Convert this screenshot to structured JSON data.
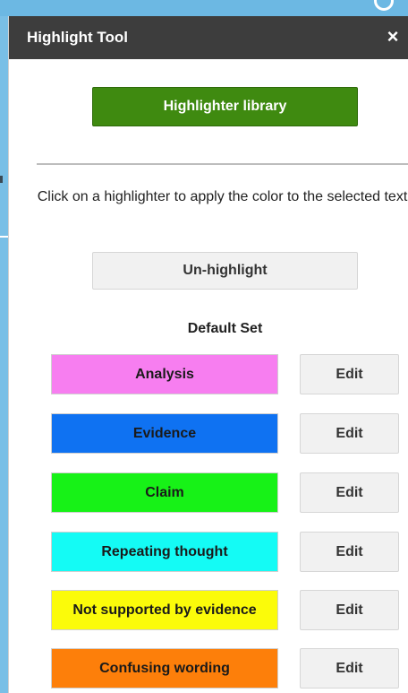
{
  "panel": {
    "title": "Highlight Tool",
    "close_label": "×"
  },
  "library_button_label": "Highlighter library",
  "instructions": "Click on a highlighter to apply the color to the selected text",
  "unhighlight_label": "Un-highlight",
  "set_title": "Default Set",
  "highlighters": [
    {
      "label": "Analysis",
      "color": "#f77ef0",
      "edit_label": "Edit"
    },
    {
      "label": "Evidence",
      "color": "#0f72f2",
      "edit_label": "Edit"
    },
    {
      "label": "Claim",
      "color": "#17f217",
      "edit_label": "Edit"
    },
    {
      "label": "Repeating thought",
      "color": "#14fbf5",
      "edit_label": "Edit"
    },
    {
      "label": "Not supported by evidence",
      "color": "#fbfb0a",
      "edit_label": "Edit"
    },
    {
      "label": "Confusing wording",
      "color": "#fd7f0a",
      "edit_label": "Edit"
    }
  ],
  "colors": {
    "header_bg": "#3d3d3d",
    "library_button": "#3f8a10",
    "page_background": "#7dc1e8"
  }
}
